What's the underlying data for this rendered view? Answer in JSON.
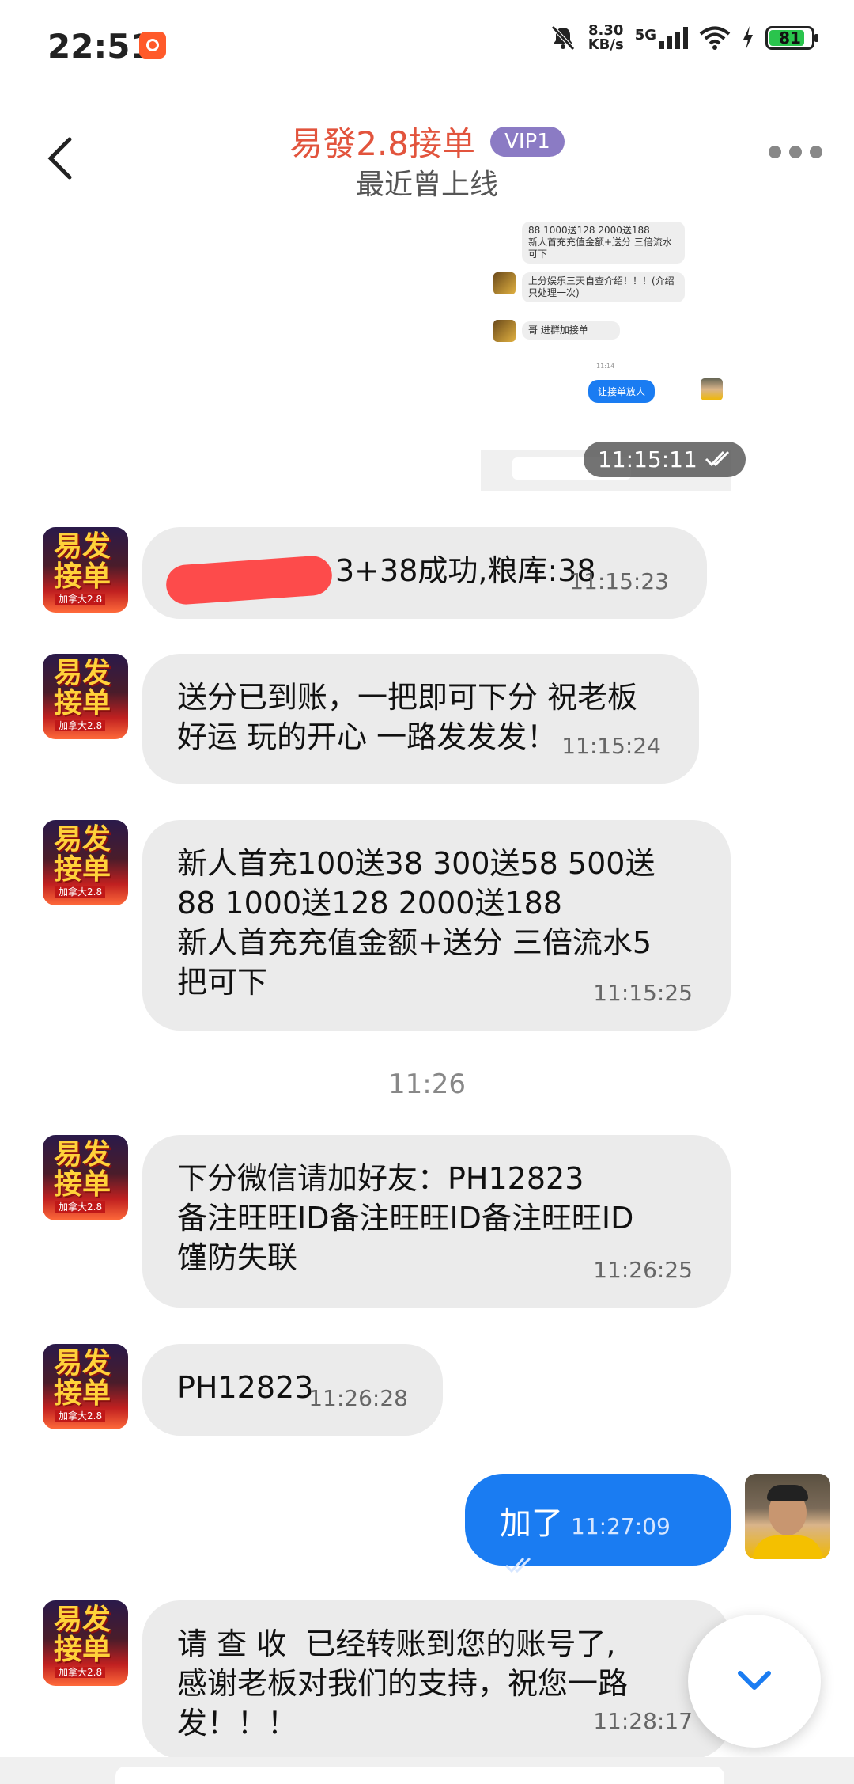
{
  "status": {
    "time": "22:51",
    "speed_value": "8.30",
    "speed_unit": "KB/s",
    "network": "5G",
    "battery": "81"
  },
  "header": {
    "title": "易發2.8接单",
    "vip": "VIP1",
    "subtitle": "最近曾上线"
  },
  "embedded": {
    "line1": "88 1000送128 2000送188",
    "line2": "新人首充充值金额+送分 三倍流水",
    "line3": "可下",
    "line4": "上分娱乐三天自查介绍！！！(介绍",
    "line5": "只处理一次)",
    "line6": "哥  进群加接单",
    "center_time": "11:14",
    "out_msg": "让接单放人",
    "overlay_time": "11:15:11"
  },
  "messages": [
    {
      "text": "3+38成功,粮库:38",
      "time": "11:15:23"
    },
    {
      "text": "送分已到账，一把即可下分 祝老板\n好运 玩的开心 一路发发发！",
      "time": "11:15:24"
    },
    {
      "text": "新人首充100送38 300送58 500送\n88 1000送128 2000送188\n新人首充充值金额+送分 三倍流水5\n把可下",
      "time": "11:15:25"
    },
    {
      "text": "下分微信请加好友：PH12823\n备注旺旺ID备注旺旺ID备注旺旺ID\n馑防失联",
      "time": "11:26:25"
    },
    {
      "text": "PH12823",
      "time": "11:26:28"
    },
    {
      "text": "请 查 收  已经转账到您的账号了,\n感谢老板对我们的支持，祝您一路\n发！！！",
      "time": "11:28:17"
    }
  ],
  "center_time": "11:26",
  "outgoing": {
    "text": "加了",
    "time": "11:27:09"
  },
  "avatar": {
    "line1": "易发",
    "line2": "接单",
    "tag": "加拿大2.8"
  }
}
